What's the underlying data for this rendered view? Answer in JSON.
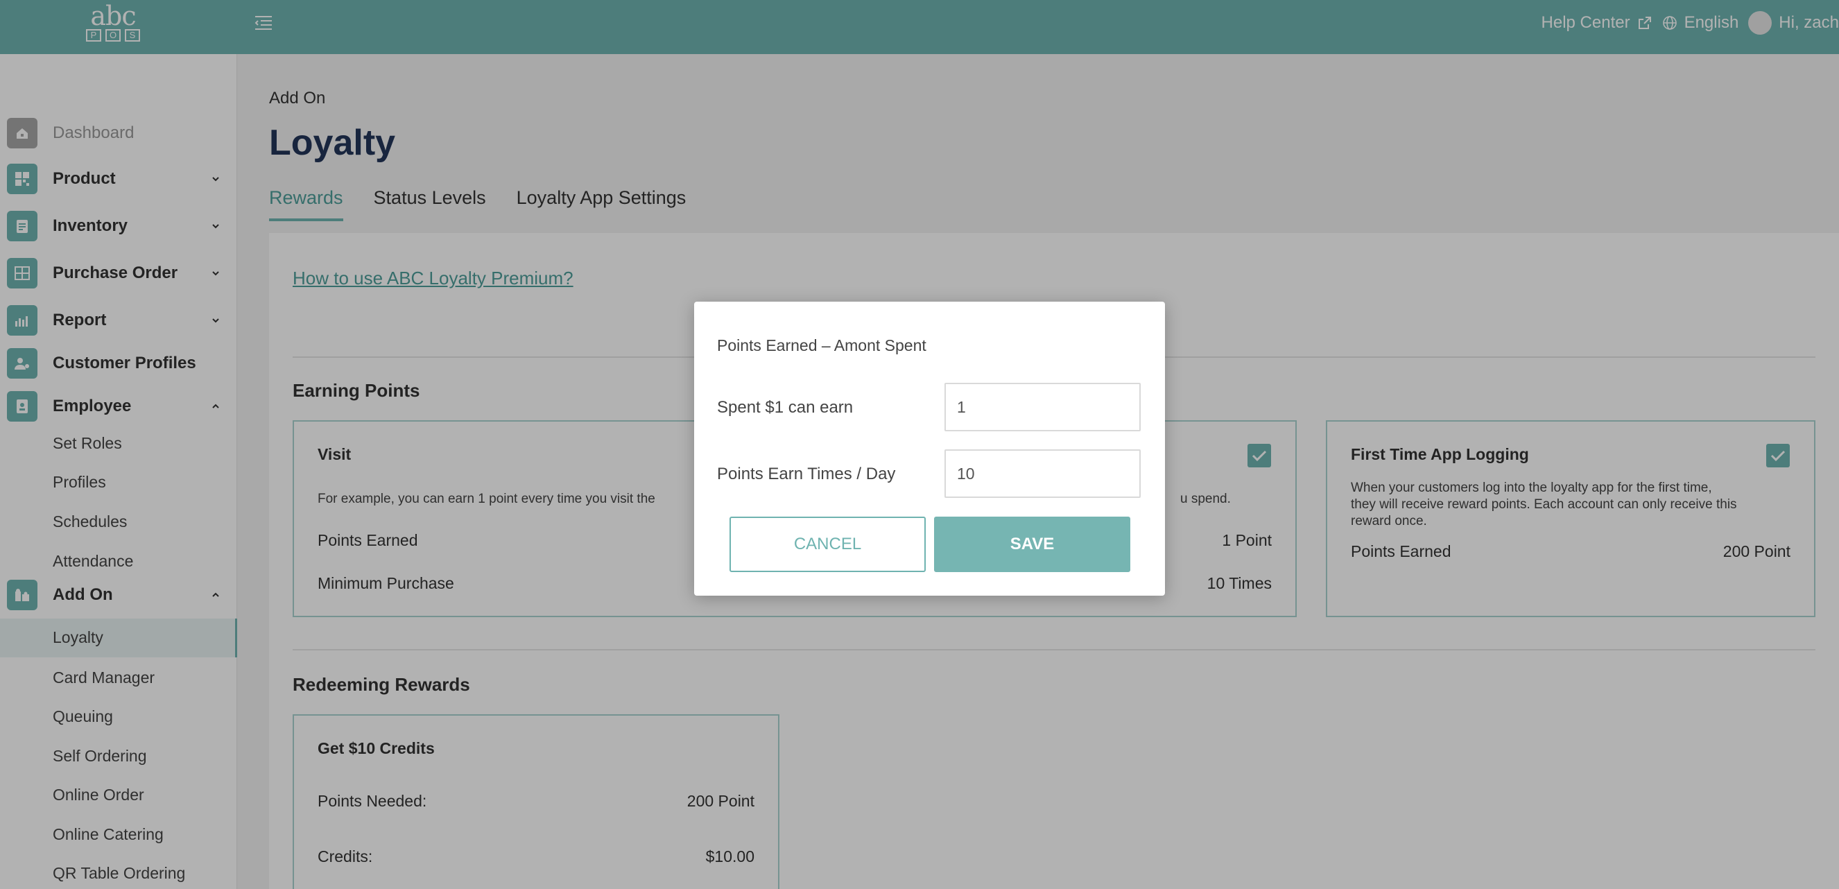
{
  "header": {
    "logo_text": "abc",
    "logo_letters": [
      "P",
      "O",
      "S"
    ],
    "help_center": "Help Center",
    "language": "English",
    "greeting": "Hi, zach"
  },
  "sidebar": {
    "items": [
      {
        "label": "Dashboard",
        "icon": "home-icon"
      },
      {
        "label": "Product",
        "icon": "grid-icon"
      },
      {
        "label": "Inventory",
        "icon": "clipboard-icon"
      },
      {
        "label": "Purchase Order",
        "icon": "invoice-icon"
      },
      {
        "label": "Report",
        "icon": "bar-chart-icon"
      },
      {
        "label": "Customer Profiles",
        "icon": "customer-icon"
      },
      {
        "label": "Employee",
        "icon": "id-badge-icon"
      },
      {
        "label": "Add On",
        "icon": "puzzle-icon"
      }
    ],
    "employee_sub": [
      "Set Roles",
      "Profiles",
      "Schedules",
      "Attendance"
    ],
    "addon_sub": [
      "Loyalty",
      "Card Manager",
      "Queuing",
      "Self Ordering",
      "Online Order",
      "Online Catering",
      "QR Table Ordering"
    ]
  },
  "main": {
    "breadcrumb": "Add On",
    "title": "Loyalty",
    "tabs": [
      "Rewards",
      "Status Levels",
      "Loyalty App Settings"
    ],
    "help_link": "How to use ABC Loyalty Premium?",
    "earning_title": "Earning Points",
    "visit_card": {
      "title": "Visit",
      "desc": "For example, you can earn 1 point every time you visit the",
      "points_label": "Points Earned",
      "min_label": "Minimum Purchase"
    },
    "spent_card": {
      "desc_tail": "u spend.",
      "points_value": "1 Point",
      "times_value": "10 Times"
    },
    "app_card": {
      "title": "First Time App Logging",
      "desc_lines": [
        "When your customers log into the loyalty app for the first time,",
        "they will receive reward points. Each account can only receive this",
        "reward once."
      ],
      "points_label": "Points Earned",
      "points_value": "200 Point"
    },
    "redeeming_title": "Redeeming Rewards",
    "credit_card": {
      "title": "Get $10 Credits",
      "needed_label": "Points Needed:",
      "needed_value": "200 Point",
      "credits_label": "Credits:",
      "credits_value": "$10.00"
    }
  },
  "modal": {
    "title": "Points Earned – Amont Spent",
    "field1_label": "Spent $1 can earn",
    "field1_value": "1",
    "field2_label": "Points Earn Times / Day",
    "field2_value": "10",
    "cancel": "CANCEL",
    "save": "SAVE"
  },
  "colors": {
    "accent": "#6fb3b0",
    "title": "#23365a"
  }
}
